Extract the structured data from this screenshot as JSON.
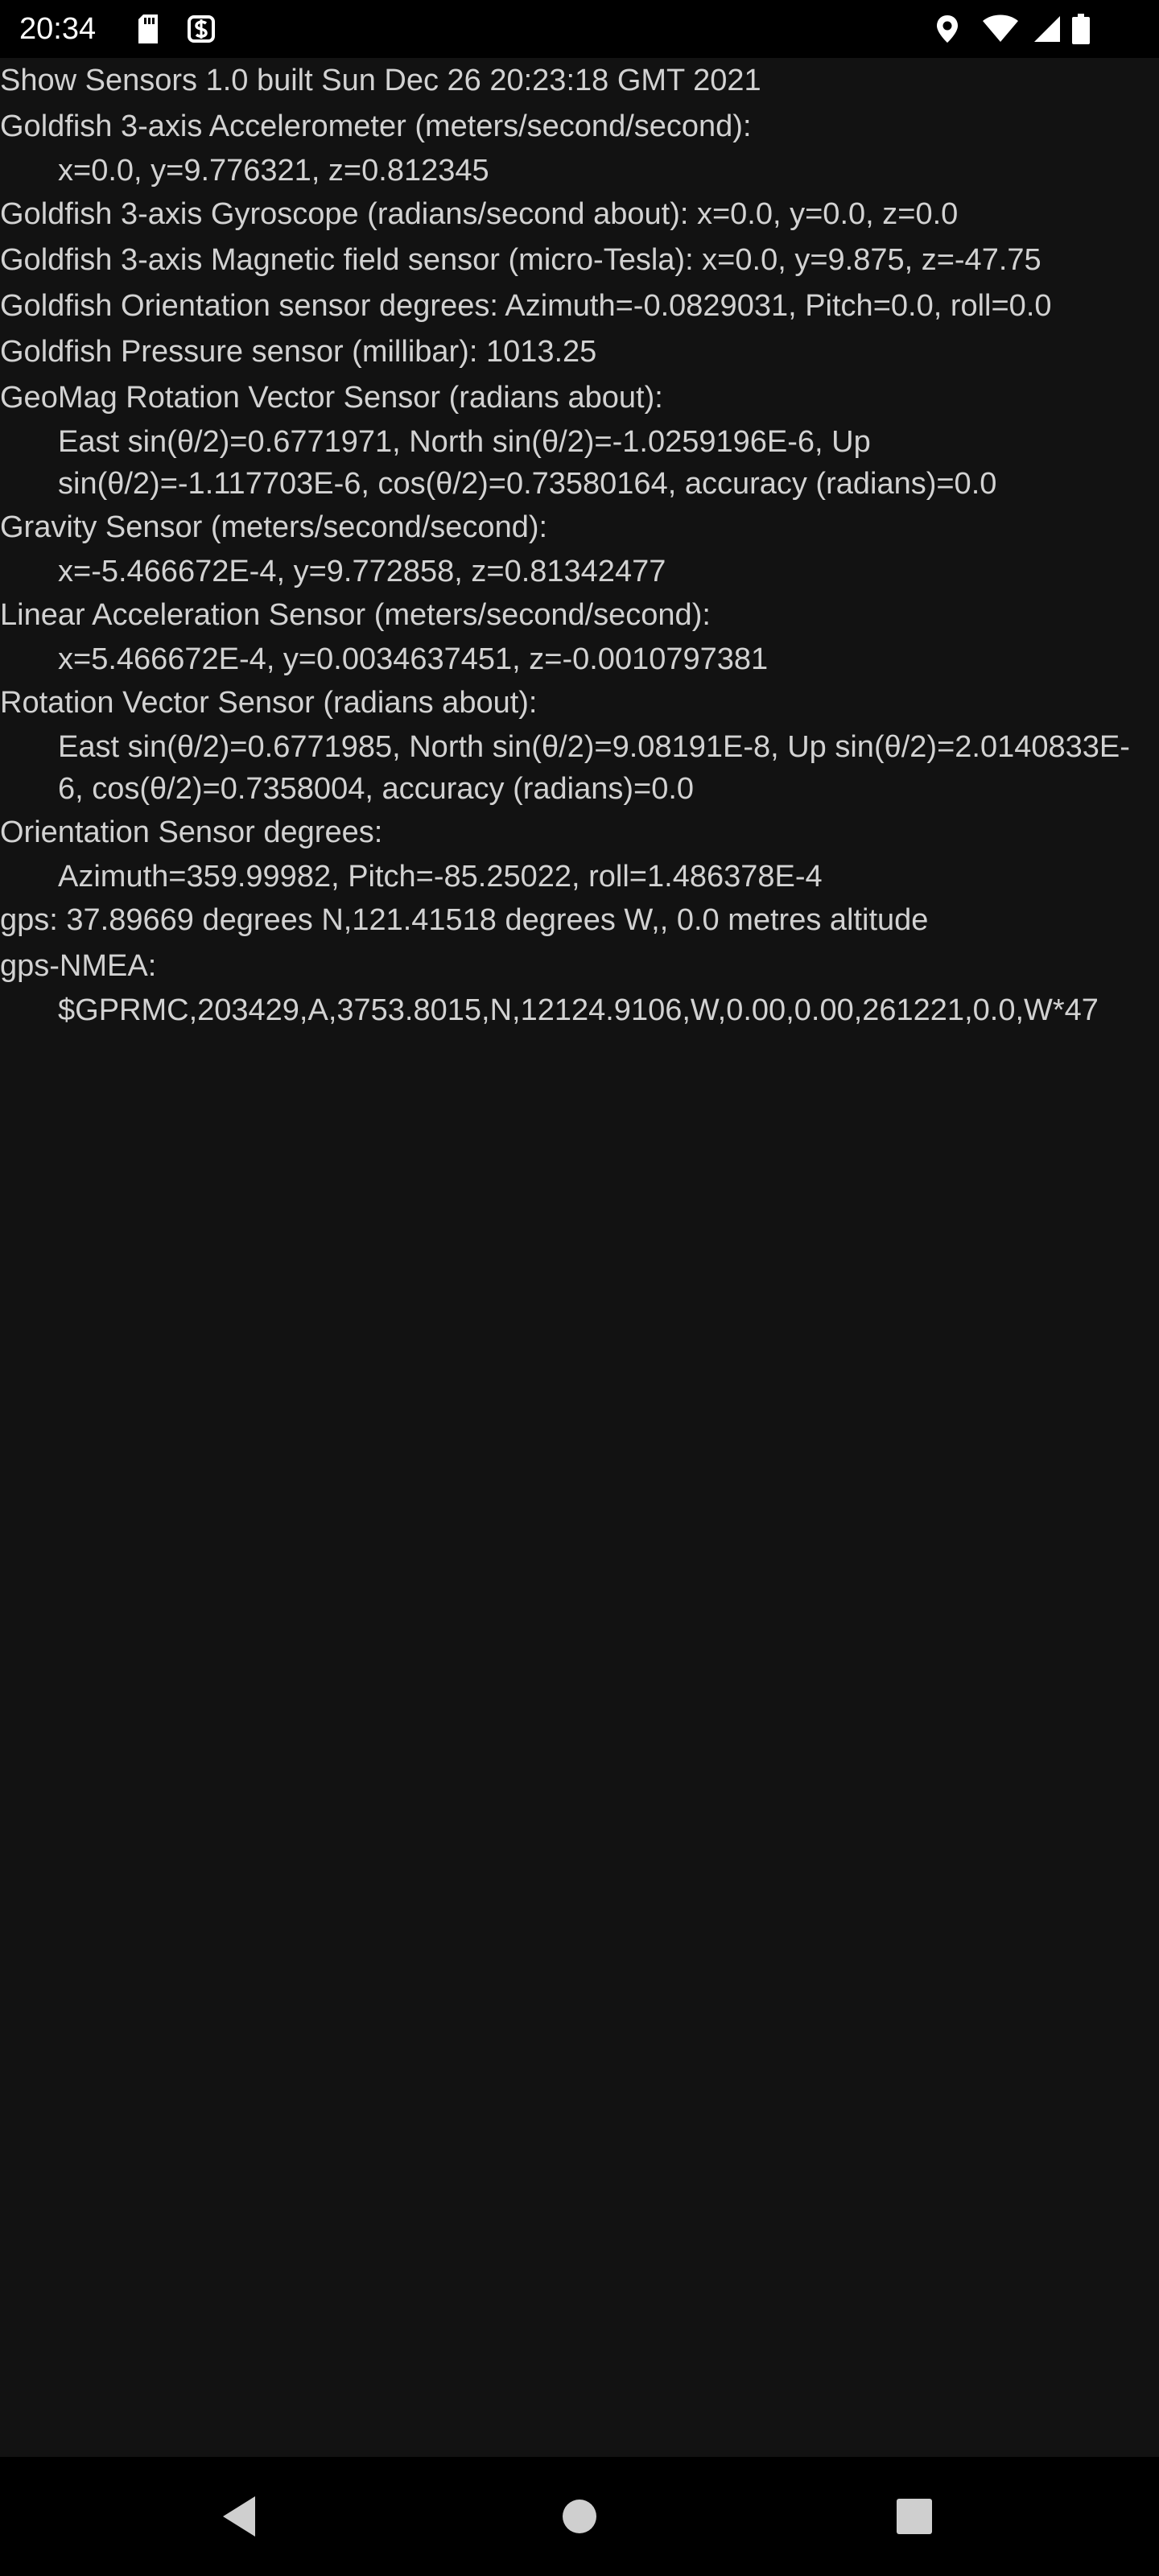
{
  "status_bar": {
    "time": "20:34",
    "left_icons": [
      "sd-card-icon",
      "data-saver-icon"
    ],
    "right_icons": [
      "location-icon",
      "wifi-icon",
      "cellular-signal-icon",
      "battery-icon"
    ]
  },
  "sensors": {
    "title": "Show Sensors 1.0 built Sun Dec 26 20:23:18 GMT 2021",
    "accelerometer_label": "Goldfish 3-axis Accelerometer  (meters/second/second):",
    "accelerometer_value": "x=0.0, y=9.776321, z=0.812345",
    "gyroscope": "Goldfish 3-axis Gyroscope  (radians/second about): x=0.0, y=0.0, z=0.0",
    "magnetic": "Goldfish 3-axis Magnetic field sensor  (micro-Tesla): x=0.0, y=9.875, z=-47.75",
    "orientation_goldfish": "Goldfish Orientation sensor degrees: Azimuth=-0.0829031, Pitch=0.0, roll=0.0",
    "pressure": "Goldfish Pressure sensor  (millibar): 1013.25",
    "geomag_label": "GeoMag Rotation Vector Sensor  (radians about):",
    "geomag_value": "East sin(θ/2)=0.6771971, North sin(θ/2)=-1.0259196E-6, Up sin(θ/2)=-1.117703E-6, cos(θ/2)=0.73580164, accuracy (radians)=0.0",
    "gravity_label": "Gravity Sensor  (meters/second/second):",
    "gravity_value": "x=-5.466672E-4, y=9.772858, z=0.81342477",
    "linear_label": "Linear Acceleration Sensor  (meters/second/second):",
    "linear_value": "x=5.466672E-4, y=0.0034637451, z=-0.0010797381",
    "rotation_label": "Rotation Vector Sensor  (radians about):",
    "rotation_value": "East sin(θ/2)=0.6771985, North sin(θ/2)=9.08191E-8, Up sin(θ/2)=2.0140833E-6, cos(θ/2)=0.7358004, accuracy (radians)=0.0",
    "orientation_label": "Orientation Sensor degrees:",
    "orientation_value": "Azimuth=359.99982, Pitch=-85.25022, roll=1.486378E-4",
    "gps": "gps: 37.89669 degrees N,121.41518 degrees W,, 0.0 metres altitude",
    "nmea_label": "gps-NMEA:",
    "nmea_value": "$GPRMC,203429,A,3753.8015,N,12124.9106,W,0.00,0.00,261221,0.0,W*47"
  },
  "nav_bar": {
    "buttons": [
      "back-icon",
      "home-icon",
      "recents-icon"
    ]
  },
  "colors": {
    "background": "#121212",
    "text": "#d2d2d2",
    "bars": "#000000"
  }
}
